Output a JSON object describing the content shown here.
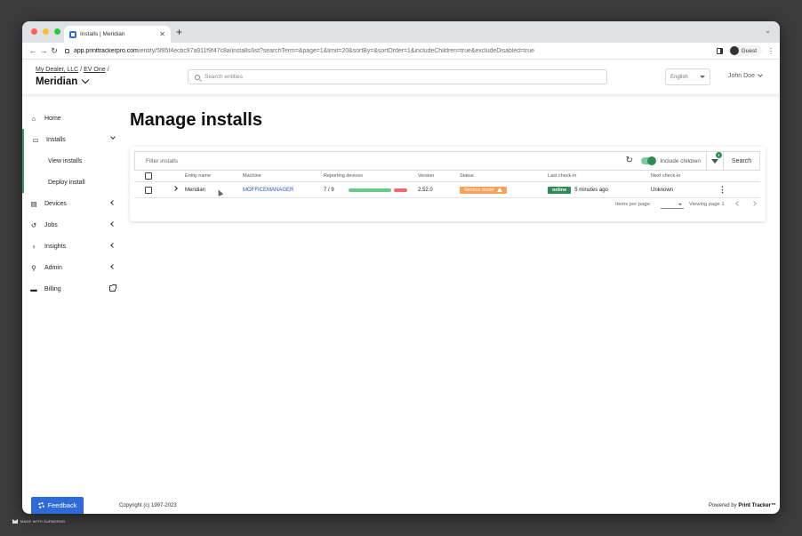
{
  "browser": {
    "tab_title": "Installs | Meridian",
    "new_tab": "+",
    "url_host": "app.printtrackerpro.com",
    "url_path": "/entity/5f85f4ecbc97a911f9f47c8a/installs/list?searchTerm=&page=1&limit=20&sortBy=&sortOrder=1&includeChildren=true&excludeDisabled=true",
    "profile": "Guest",
    "traffic_light_colors": [
      "#ff5f57",
      "#febc2e",
      "#28c840"
    ]
  },
  "header": {
    "breadcrumb": [
      "My Dealer, LLC",
      "EV One"
    ],
    "breadcrumb_sep": "/",
    "entity_name": "Meridian",
    "search_placeholder": "Search entities",
    "language": "English",
    "user": "John Doe"
  },
  "sidebar": {
    "items": [
      {
        "label": "Home",
        "icon": "home-icon"
      },
      {
        "label": "Installs",
        "icon": "monitor-icon"
      },
      {
        "label": "View installs"
      },
      {
        "label": "Deploy install"
      },
      {
        "label": "Devices",
        "icon": "printer-icon"
      },
      {
        "label": "Jobs",
        "icon": "history-icon"
      },
      {
        "label": "Insights",
        "icon": "lightbulb-icon"
      },
      {
        "label": "Admin",
        "icon": "wrench-icon"
      },
      {
        "label": "Billing",
        "icon": "credit-card-icon"
      }
    ],
    "accent_color": "#3a9b68"
  },
  "main": {
    "title": "Manage installs",
    "filter_placeholder": "Filter installs",
    "include_children_label": "Include children",
    "include_children": true,
    "filter_count": "1",
    "search_label": "Search",
    "columns": [
      "Entity name",
      "Machine",
      "Reporting devices",
      "Version",
      "Status",
      "Last check-in",
      "Next check-in"
    ],
    "rows": [
      {
        "entity_name": "Meridian",
        "machine": "MOFFICEMANAGER",
        "reporting_devices": "7 / 9",
        "reporting_fraction": 0.78,
        "version": "2.52.0",
        "status": "Service mode",
        "online": "online",
        "last_check_in": "5 minutes ago",
        "next_check_in": "Unknown"
      }
    ],
    "items_per_page_label": "Items per page:",
    "viewing_page": "Viewing page 1"
  },
  "footer": {
    "feedback": "Feedback",
    "copyright": "Copyright (c) 1997-2023",
    "powered_prefix": "Powered by",
    "powered_brand": "Print Tracker™"
  },
  "watermark": "MADE WITH SUPADEMO"
}
